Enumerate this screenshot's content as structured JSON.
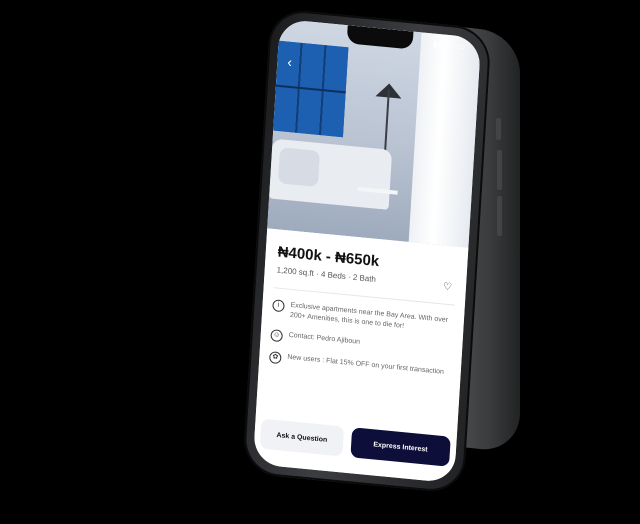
{
  "listing": {
    "price": "₦400k - ₦650k",
    "specs": "1,200 sq.ft · 4 Beds · 2 Bath",
    "description": "Exclusive apartments near the Bay Area. With over 200+ Amenities, this is one to die for!",
    "contact": "Contact: Pedro Ajiboun",
    "promo": "New users : Flat 15% OFF on your first transaction"
  },
  "actions": {
    "ask_label": "Ask a Question",
    "express_label": "Express Interest"
  },
  "colors": {
    "primary": "#0d0f3a",
    "background": "#000000",
    "cabinet_blue": "#1d5fb0"
  },
  "icons": {
    "back": "back-chevron-icon",
    "favorite": "heart-icon",
    "info": "info-icon",
    "contact": "contact-icon",
    "gift": "gift-icon"
  }
}
